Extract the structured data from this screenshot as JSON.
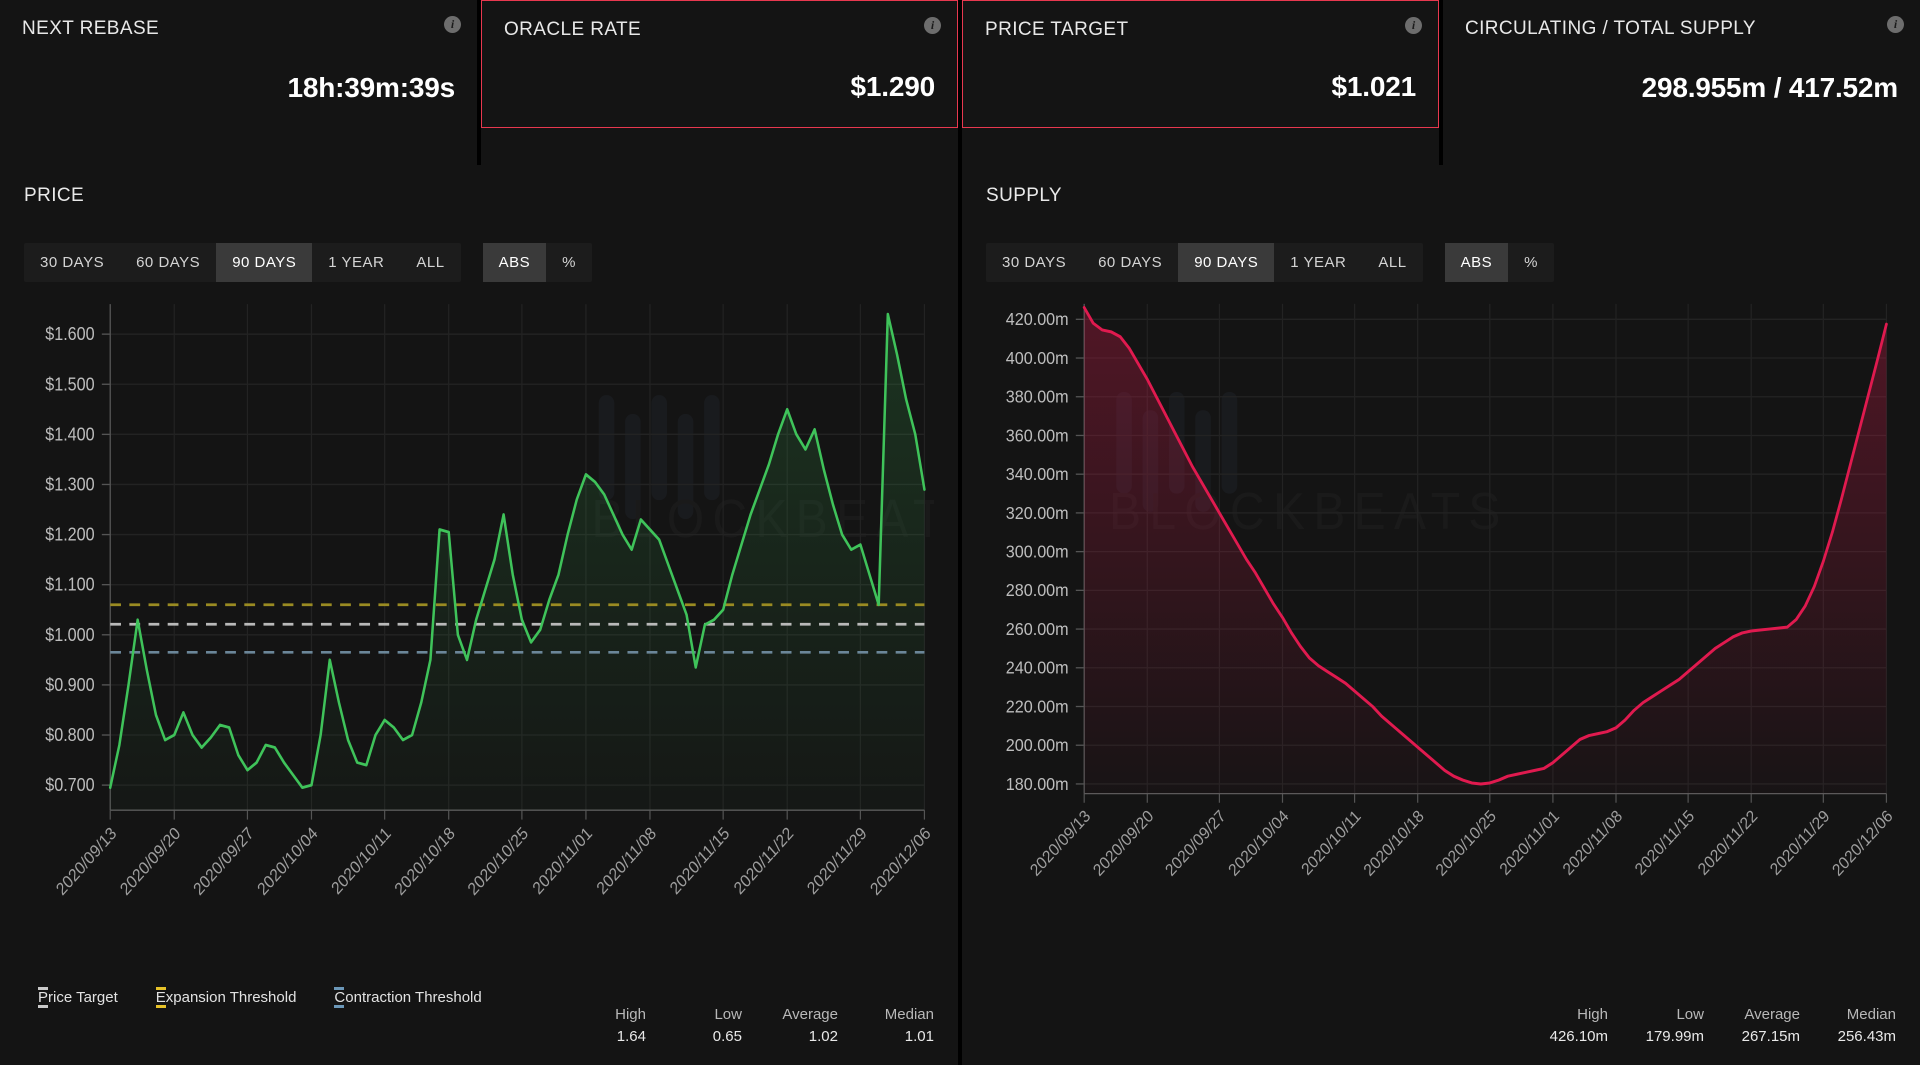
{
  "header": {
    "cards": [
      {
        "title": "NEXT REBASE",
        "value": "18h:39m:39s",
        "highlight": false,
        "info": "info-icon"
      },
      {
        "title": "ORACLE RATE",
        "value": "$1.290",
        "highlight": true,
        "info": "info-icon"
      },
      {
        "title": "PRICE TARGET",
        "value": "$1.021",
        "highlight": true,
        "info": "info-icon"
      },
      {
        "title": "CIRCULATING / TOTAL SUPPLY",
        "value": "298.955m / 417.52m",
        "highlight": false,
        "info": "info-icon"
      }
    ],
    "highlight_color": "#e8384f"
  },
  "price_panel": {
    "title": "PRICE",
    "range_tabs": [
      {
        "label": "30 DAYS",
        "active": false
      },
      {
        "label": "60 DAYS",
        "active": false
      },
      {
        "label": "90 DAYS",
        "active": true
      },
      {
        "label": "1 YEAR",
        "active": false
      },
      {
        "label": "ALL",
        "active": false
      }
    ],
    "unit_tabs": [
      {
        "label": "ABS",
        "active": true
      },
      {
        "label": "%",
        "active": false
      }
    ],
    "legend": [
      {
        "label": "Price Target",
        "color": "#c9c9c9"
      },
      {
        "label": "Expansion Threshold",
        "color": "#e6c229"
      },
      {
        "label": "Contraction Threshold",
        "color": "#6b97b8"
      }
    ],
    "stats": [
      {
        "key": "High",
        "value": "1.64"
      },
      {
        "key": "Low",
        "value": "0.65"
      },
      {
        "key": "Average",
        "value": "1.02"
      },
      {
        "key": "Median",
        "value": "1.01"
      }
    ]
  },
  "supply_panel": {
    "title": "SUPPLY",
    "range_tabs": [
      {
        "label": "30 DAYS",
        "active": false
      },
      {
        "label": "60 DAYS",
        "active": false
      },
      {
        "label": "90 DAYS",
        "active": true
      },
      {
        "label": "1 YEAR",
        "active": false
      },
      {
        "label": "ALL",
        "active": false
      }
    ],
    "unit_tabs": [
      {
        "label": "ABS",
        "active": true
      },
      {
        "label": "%",
        "active": false
      }
    ],
    "stats": [
      {
        "key": "High",
        "value": "426.10m"
      },
      {
        "key": "Low",
        "value": "179.99m"
      },
      {
        "key": "Average",
        "value": "267.15m"
      },
      {
        "key": "Median",
        "value": "256.43m"
      }
    ]
  },
  "watermark": {
    "text": "BLOCKBEATS"
  },
  "chart_data": [
    {
      "type": "line",
      "id": "price-chart",
      "title": "PRICE",
      "xlabel": "",
      "ylabel": "",
      "ylim": [
        0.65,
        1.66
      ],
      "grid": true,
      "line_color": "#3fc35a",
      "yticks": [
        "$0.700",
        "$0.800",
        "$0.900",
        "$1.000",
        "$1.100",
        "$1.200",
        "$1.300",
        "$1.400",
        "$1.500",
        "$1.600"
      ],
      "ytick_values": [
        0.7,
        0.8,
        0.9,
        1.0,
        1.1,
        1.2,
        1.3,
        1.4,
        1.5,
        1.6
      ],
      "xticks": [
        "2020/09/13",
        "2020/09/20",
        "2020/09/27",
        "2020/10/04",
        "2020/10/11",
        "2020/10/18",
        "2020/10/25",
        "2020/11/01",
        "2020/11/08",
        "2020/11/15",
        "2020/11/22",
        "2020/11/29",
        "2020/12/06"
      ],
      "reference_lines": [
        {
          "name": "Expansion Threshold",
          "value": 1.06,
          "color": "#9a8b22",
          "style": "dashed"
        },
        {
          "name": "Price Target",
          "value": 1.021,
          "color": "#b9b9b9",
          "style": "dashed"
        },
        {
          "name": "Contraction Threshold",
          "value": 0.965,
          "color": "#6b8699",
          "style": "dashed"
        }
      ],
      "values": [
        0.695,
        0.78,
        0.9,
        1.03,
        0.93,
        0.84,
        0.79,
        0.8,
        0.845,
        0.8,
        0.775,
        0.795,
        0.82,
        0.815,
        0.76,
        0.73,
        0.745,
        0.78,
        0.775,
        0.745,
        0.72,
        0.695,
        0.7,
        0.8,
        0.95,
        0.865,
        0.79,
        0.745,
        0.74,
        0.8,
        0.83,
        0.815,
        0.79,
        0.8,
        0.865,
        0.95,
        1.21,
        1.205,
        1.0,
        0.95,
        1.03,
        1.09,
        1.15,
        1.24,
        1.12,
        1.03,
        0.985,
        1.01,
        1.07,
        1.12,
        1.2,
        1.27,
        1.32,
        1.305,
        1.28,
        1.24,
        1.2,
        1.17,
        1.23,
        1.21,
        1.19,
        1.14,
        1.09,
        1.04,
        0.935,
        1.02,
        1.03,
        1.05,
        1.12,
        1.18,
        1.24,
        1.29,
        1.34,
        1.4,
        1.45,
        1.4,
        1.37,
        1.41,
        1.33,
        1.26,
        1.2,
        1.17,
        1.18,
        1.12,
        1.06,
        1.64,
        1.56,
        1.47,
        1.4,
        1.29
      ]
    },
    {
      "type": "area",
      "id": "supply-chart",
      "title": "SUPPLY",
      "xlabel": "",
      "ylabel": "",
      "ylim": [
        175,
        428
      ],
      "grid": true,
      "line_color": "#e01a4f",
      "yticks": [
        "180.00m",
        "200.00m",
        "220.00m",
        "240.00m",
        "260.00m",
        "280.00m",
        "300.00m",
        "320.00m",
        "340.00m",
        "360.00m",
        "380.00m",
        "400.00m",
        "420.00m"
      ],
      "ytick_values": [
        180,
        200,
        220,
        240,
        260,
        280,
        300,
        320,
        340,
        360,
        380,
        400,
        420
      ],
      "xticks": [
        "2020/09/13",
        "2020/09/20",
        "2020/09/27",
        "2020/10/04",
        "2020/10/11",
        "2020/10/18",
        "2020/10/25",
        "2020/11/01",
        "2020/11/08",
        "2020/11/15",
        "2020/11/22",
        "2020/11/29",
        "2020/12/06"
      ],
      "values": [
        426.1,
        418.0,
        414.5,
        413.5,
        411.0,
        405.0,
        397.0,
        389.0,
        380.0,
        371.0,
        362.0,
        353.0,
        344.0,
        336.0,
        328.0,
        320.0,
        312.0,
        304.0,
        296.0,
        289.0,
        281.0,
        273.0,
        266.0,
        258.0,
        251.0,
        245.0,
        241.0,
        238.0,
        235.0,
        232.0,
        228.0,
        224.0,
        220.0,
        215.0,
        211.0,
        207.0,
        203.0,
        199.0,
        195.0,
        191.0,
        187.0,
        184.0,
        182.0,
        180.5,
        179.99,
        180.5,
        182.0,
        184.0,
        185.0,
        186.0,
        187.0,
        188.0,
        191.0,
        195.0,
        199.0,
        203.0,
        205.0,
        206.0,
        207.0,
        209.0,
        213.0,
        218.0,
        222.0,
        225.0,
        228.0,
        231.0,
        234.0,
        238.0,
        242.0,
        246.0,
        250.0,
        253.0,
        256.0,
        258.0,
        259.0,
        259.5,
        260.0,
        260.5,
        261.0,
        265.0,
        272.0,
        282.0,
        295.0,
        310.0,
        327.0,
        345.0,
        363.0,
        381.0,
        399.0,
        417.5
      ]
    }
  ]
}
